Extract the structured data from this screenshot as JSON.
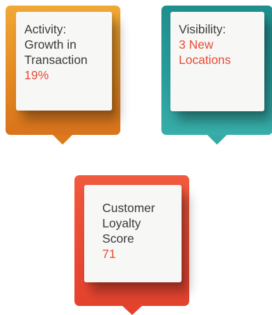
{
  "cards": [
    {
      "id": "activity",
      "label": "Activity:\nGrowth in\nTransaction",
      "value": "19%",
      "color": "#e48b22"
    },
    {
      "id": "visibility",
      "label": "Visibility:",
      "value": "3 New\nLocations",
      "color": "#2a9e9b"
    },
    {
      "id": "loyalty",
      "label": "Customer\nLoyalty\nScore",
      "value": "71",
      "color": "#ea4a33"
    }
  ],
  "colors": {
    "value_text": "#ea4a35",
    "label_text": "#3a3a3a",
    "card_bg": "#f7f7f5"
  }
}
